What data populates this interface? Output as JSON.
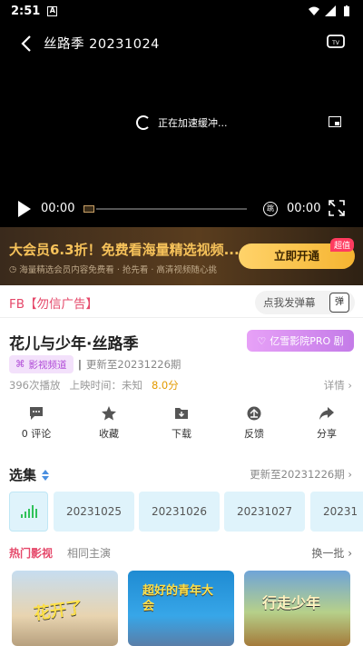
{
  "status_bar": {
    "time": "2:51",
    "app_icon_letter": "A"
  },
  "player": {
    "title": "丝路季   20231024",
    "buffering_text": "正在加速缓冲...",
    "current_time": "00:00",
    "duration": "00:00",
    "tv_mode_label": "跳"
  },
  "vip_banner": {
    "title": "大会员6.3折！免费看海量精选视频...",
    "subtitle": "海量精选会员内容免费看 · 抢先看 · 高清视频随心挑",
    "button": "立即开通",
    "badge": "超值"
  },
  "ad_row": {
    "text": "FB【勿信广告】",
    "danmu_label": "点我发弹幕",
    "danmu_icon": "弹"
  },
  "video": {
    "title": "花儿与少年·丝路季",
    "pro_label": "亿雪影院PRO 剧",
    "channel": "影视频道",
    "update_prefix": "|",
    "update_text": "更新至20231226期",
    "plays": "396次播放",
    "release": "上映时间：未知",
    "score": "8.0分",
    "detail_label": "详情"
  },
  "actions": [
    {
      "label": "0 评论",
      "icon": "comment-icon"
    },
    {
      "label": "收藏",
      "icon": "star-icon"
    },
    {
      "label": "下载",
      "icon": "download-icon"
    },
    {
      "label": "反馈",
      "icon": "feedback-icon"
    },
    {
      "label": "分享",
      "icon": "share-icon"
    }
  ],
  "episodes": {
    "heading": "选集",
    "update_text": "更新至20231226期",
    "items": [
      "20231025",
      "20231026",
      "20231027",
      "20231"
    ]
  },
  "recommend": {
    "tabs": [
      "热门影视",
      "相同主演"
    ],
    "swap_label": "换一批",
    "posters": [
      "花开了",
      "超好的青年大会",
      "行走少年"
    ]
  },
  "colors": {
    "accent": "#e5486a",
    "gold": "#f6c25a",
    "pro": "#c47be8"
  }
}
